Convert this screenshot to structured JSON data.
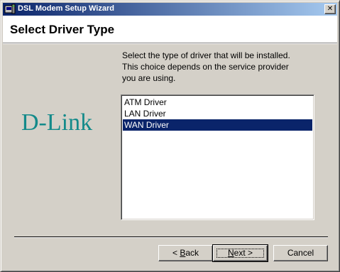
{
  "window": {
    "title": "DSL Modem Setup Wizard",
    "close_glyph": "✕"
  },
  "header": {
    "title": "Select Driver Type"
  },
  "logo": {
    "text": "D-Link",
    "color": "#138a8a"
  },
  "description": {
    "lines": [
      "Select the type of driver that will be installed.",
      "This choice depends on the service provider",
      "you are using."
    ]
  },
  "driver_list": {
    "items": [
      {
        "label": "ATM Driver",
        "selected": false
      },
      {
        "label": "LAN Driver",
        "selected": false
      },
      {
        "label": "WAN Driver",
        "selected": true
      }
    ],
    "selection_color": "#0a246a"
  },
  "buttons": {
    "back": {
      "prefix": "< ",
      "accel": "B",
      "rest": "ack"
    },
    "next": {
      "accel": "N",
      "rest": "ext >"
    },
    "cancel": {
      "label": "Cancel"
    }
  },
  "colors": {
    "titlebar_start": "#0a246a",
    "titlebar_end": "#a6caf0",
    "face": "#d4d0c8"
  },
  "icons": {
    "title_icon": "setup-wizard-icon",
    "close_icon": "close-icon"
  }
}
